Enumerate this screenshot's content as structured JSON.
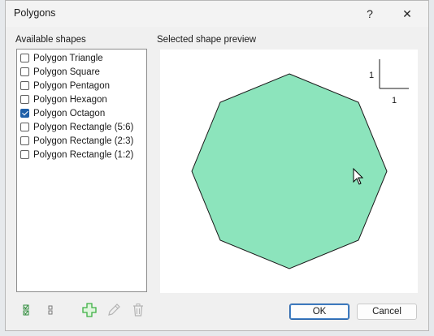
{
  "window": {
    "title": "Polygons",
    "help_glyph": "?",
    "close_glyph": "✕"
  },
  "shapes_panel": {
    "label": "Available shapes",
    "items": [
      {
        "label": "Polygon Triangle",
        "checked": false
      },
      {
        "label": "Polygon Square",
        "checked": false
      },
      {
        "label": "Polygon Pentagon",
        "checked": false
      },
      {
        "label": "Polygon Hexagon",
        "checked": false
      },
      {
        "label": "Polygon Octagon",
        "checked": true
      },
      {
        "label": "Polygon Rectangle (5:6)",
        "checked": false
      },
      {
        "label": "Polygon Rectangle (2:3)",
        "checked": false
      },
      {
        "label": "Polygon Rectangle (1:2)",
        "checked": false
      }
    ]
  },
  "preview_panel": {
    "label": "Selected shape preview",
    "shape": "octagon",
    "fill_color": "#8ce4bc",
    "stroke_color": "#1a1a1a",
    "scale_x_label": "1",
    "scale_y_label": "1"
  },
  "toolbar": {
    "icons": [
      "select-all-icon",
      "drag-handle-icon",
      "add-icon",
      "edit-icon",
      "delete-icon"
    ],
    "add_color": "#3cb043"
  },
  "buttons": {
    "ok": "OK",
    "cancel": "Cancel"
  }
}
